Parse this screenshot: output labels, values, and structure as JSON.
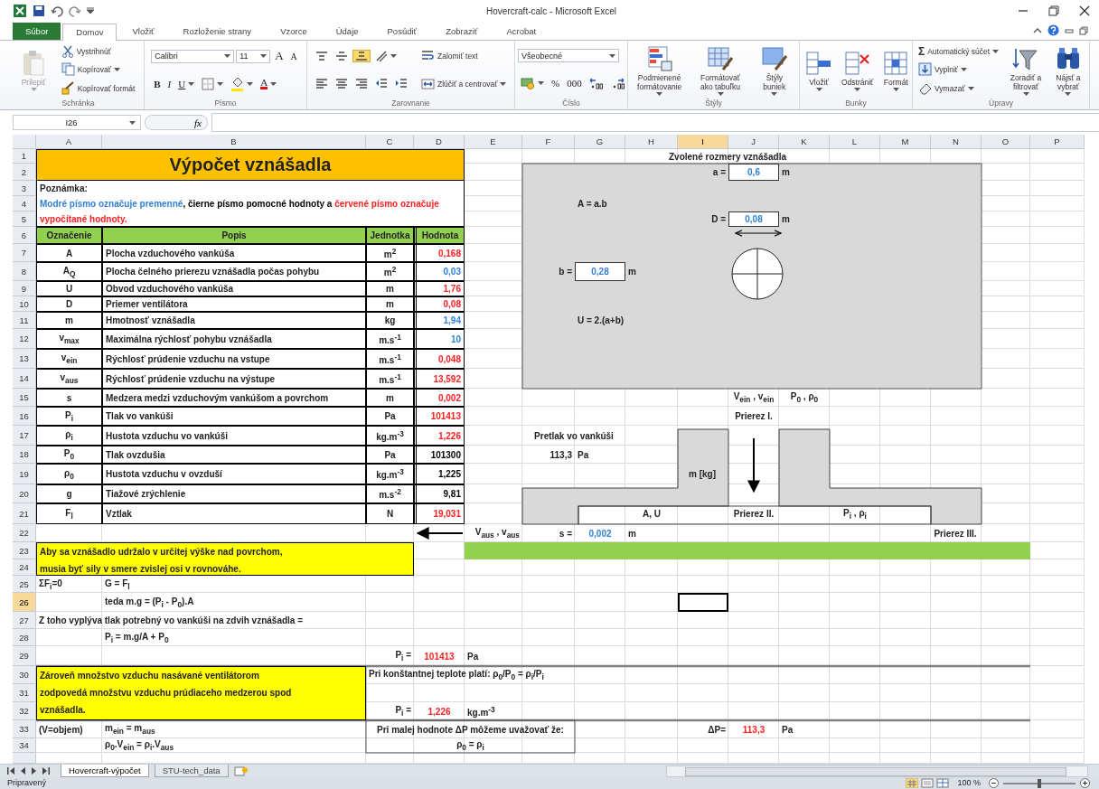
{
  "window": {
    "title": "Hovercraft-calc - Microsoft Excel"
  },
  "tabs": [
    {
      "label": "Súbor",
      "kind": "file",
      "selected": false
    },
    {
      "label": "Domov",
      "kind": "tab",
      "selected": true
    },
    {
      "label": "Vložiť",
      "kind": "tab",
      "selected": false
    },
    {
      "label": "Rozloženie strany",
      "kind": "tab",
      "selected": false
    },
    {
      "label": "Vzorce",
      "kind": "tab",
      "selected": false
    },
    {
      "label": "Údaje",
      "kind": "tab",
      "selected": false
    },
    {
      "label": "Posúdiť",
      "kind": "tab",
      "selected": false
    },
    {
      "label": "Zobraziť",
      "kind": "tab",
      "selected": false
    },
    {
      "label": "Acrobat",
      "kind": "tab",
      "selected": false
    }
  ],
  "ribbon": [
    {
      "label": "Schránka",
      "columns": [
        [
          [
            {
              "kind": "large",
              "label": "Prilepiť",
              "disabled": true,
              "menu": true
            }
          ]
        ],
        [
          [
            {
              "kind": "small",
              "label": "Vystrihnúť",
              "disabled": false
            }
          ],
          [
            {
              "kind": "small",
              "label": "Kopírovať",
              "disabled": false,
              "menu": true
            }
          ],
          [
            {
              "kind": "small",
              "label": "Kopírovať formát",
              "disabled": false
            }
          ]
        ]
      ]
    },
    {
      "label": "Písmo",
      "columns": [
        [
          [
            {
              "kind": "field",
              "label": "Calibri"
            },
            {
              "kind": "field",
              "label": "11"
            },
            {
              "kind": "grow",
              "label": "A"
            },
            {
              "kind": "shrink",
              "label": "A"
            }
          ],
          [
            {
              "kind": "bold",
              "label": "B"
            },
            {
              "kind": "italic",
              "label": "I"
            },
            {
              "kind": "underline",
              "label": "U",
              "menu": true
            },
            {
              "kind": "icon",
              "menu": true
            },
            {
              "kind": "icon",
              "menu": true
            },
            {
              "kind": "font-color",
              "label": "A",
              "menu": true
            }
          ]
        ]
      ]
    },
    {
      "label": "Zarovnanie",
      "columns": [
        [
          [
            {
              "kind": "icon",
              "selected": false
            },
            {
              "kind": "icon",
              "selected": false
            },
            {
              "kind": "icon",
              "selected": true
            },
            {
              "kind": "icon",
              "selected": false,
              "menu": true
            }
          ],
          [
            {
              "kind": "icon",
              "selected": false
            },
            {
              "kind": "icon",
              "selected": false
            },
            {
              "kind": "icon",
              "selected": false
            },
            {
              "kind": "icon",
              "selected": false
            },
            {
              "kind": "icon",
              "selected": false
            }
          ]
        ],
        [
          [
            {
              "kind": "small",
              "label": "Zalomiť text"
            }
          ],
          [
            {
              "kind": "small",
              "label": "Zlúčiť a centrovať",
              "menu": true
            }
          ]
        ]
      ]
    },
    {
      "label": "Číslo",
      "columns": [
        [
          [
            {
              "kind": "field",
              "label": "Všeobecné"
            }
          ],
          [
            {
              "kind": "icon",
              "menu": true
            },
            {
              "kind": "glyph",
              "label": "%"
            },
            {
              "kind": "glyph",
              "label": "000"
            },
            {
              "kind": "icon"
            },
            {
              "kind": "icon"
            }
          ]
        ]
      ]
    },
    {
      "label": "Štýly",
      "columns": [
        [
          [
            {
              "kind": "large",
              "label": "Podmienené formátovanie",
              "menu": true
            }
          ]
        ],
        [
          [
            {
              "kind": "large",
              "label": "Formátovať ako tabuľku",
              "menu": true
            }
          ]
        ],
        [
          [
            {
              "kind": "large",
              "label": "Štýly buniek",
              "menu": true
            }
          ]
        ]
      ]
    },
    {
      "label": "Bunky",
      "columns": [
        [
          [
            {
              "kind": "large",
              "label": "Vložiť",
              "menu": true
            }
          ]
        ],
        [
          [
            {
              "kind": "large",
              "label": "Odstrániť",
              "menu": true
            }
          ]
        ],
        [
          [
            {
              "kind": "large",
              "label": "Formát",
              "menu": true
            }
          ]
        ]
      ]
    },
    {
      "label": "Úpravy",
      "columns": [
        [
          [
            {
              "kind": "small",
              "glyph": "Σ",
              "label": "Automatický súčet",
              "menu": true
            }
          ],
          [
            {
              "kind": "small",
              "label": "Vyplniť",
              "menu": true
            }
          ],
          [
            {
              "kind": "small",
              "label": "Vymazať",
              "menu": true
            }
          ]
        ],
        [
          [
            {
              "kind": "large",
              "label": "Zoradiť a filtrovať",
              "menu": true
            }
          ]
        ],
        [
          [
            {
              "kind": "large",
              "label": "Nájsť a vybrať",
              "menu": true
            }
          ]
        ]
      ]
    }
  ],
  "formula_bar": {
    "name_box": "I26",
    "function_label": "fx"
  },
  "column_headers": [
    {
      "label": "A",
      "selected": false
    },
    {
      "label": "B",
      "selected": false
    },
    {
      "label": "C",
      "selected": false
    },
    {
      "label": "D",
      "selected": false
    },
    {
      "label": "E",
      "selected": false
    },
    {
      "label": "F",
      "selected": false
    },
    {
      "label": "G",
      "selected": false
    },
    {
      "label": "H",
      "selected": false
    },
    {
      "label": "I",
      "selected": true
    },
    {
      "label": "J",
      "selected": false
    },
    {
      "label": "K",
      "selected": false
    },
    {
      "label": "L",
      "selected": false
    },
    {
      "label": "M",
      "selected": false
    },
    {
      "label": "N",
      "selected": false
    },
    {
      "label": "O",
      "selected": false
    },
    {
      "label": "P",
      "selected": false
    }
  ],
  "row_headers": [
    {
      "label": "1",
      "selected": false
    },
    {
      "label": "2",
      "selected": false
    },
    {
      "label": "3",
      "selected": false
    },
    {
      "label": "4",
      "selected": false
    },
    {
      "label": "5",
      "selected": false
    },
    {
      "label": "6",
      "selected": false
    },
    {
      "label": "7",
      "selected": false
    },
    {
      "label": "8",
      "selected": false
    },
    {
      "label": "9",
      "selected": false
    },
    {
      "label": "10",
      "selected": false
    },
    {
      "label": "11",
      "selected": false
    },
    {
      "label": "12",
      "selected": false
    },
    {
      "label": "13",
      "selected": false
    },
    {
      "label": "14",
      "selected": false
    },
    {
      "label": "15",
      "selected": false
    },
    {
      "label": "16",
      "selected": false
    },
    {
      "label": "17",
      "selected": false
    },
    {
      "label": "18",
      "selected": false
    },
    {
      "label": "19",
      "selected": false
    },
    {
      "label": "20",
      "selected": false
    },
    {
      "label": "21",
      "selected": false
    },
    {
      "label": "22",
      "selected": false
    },
    {
      "label": "23",
      "selected": false
    },
    {
      "label": "24",
      "selected": false
    },
    {
      "label": "25",
      "selected": false
    },
    {
      "label": "26",
      "selected": true
    },
    {
      "label": "27",
      "selected": false
    },
    {
      "label": "28",
      "selected": false
    },
    {
      "label": "29",
      "selected": false
    },
    {
      "label": "30",
      "selected": false
    },
    {
      "label": "31",
      "selected": false
    },
    {
      "label": "32",
      "selected": false
    },
    {
      "label": "33",
      "selected": false
    },
    {
      "label": "34",
      "selected": false
    }
  ],
  "sheet_title": "Výpočet vznášadla",
  "note_label": "Poznámka:",
  "note": [
    {
      "text": "Modré písmo označuje premenné",
      "color": "#2f80d8"
    },
    {
      "text": ", čierne písmo pomocné hodnoty a ",
      "color": "#000000"
    },
    {
      "text": "červené písmo označuje vypočítané hodnoty.",
      "color": "#ff2020"
    }
  ],
  "table": {
    "columns": [
      "Označenie",
      "Popis",
      "Jednotka",
      "Hodnota"
    ],
    "rows": [
      {
        "symbol": "A",
        "description": "Plocha vzduchového vankúša",
        "unit": "m$^{2}$",
        "value": "0,168",
        "color": "#ff2020"
      },
      {
        "symbol": "A$_{Q}$",
        "description": "Plocha čelného prierezu vznášadla počas pohybu",
        "unit": "m$^{2}$",
        "value": "0,03",
        "color": "#2f80d8"
      },
      {
        "symbol": "U",
        "description": "Obvod vzduchového vankúša",
        "unit": "m",
        "value": "1,76",
        "color": "#ff2020"
      },
      {
        "symbol": "D",
        "description": "Priemer ventilátora",
        "unit": "m",
        "value": "0,08",
        "color": "#ff2020"
      },
      {
        "symbol": "m",
        "description": "Hmotnosť vznášadla",
        "unit": "kg",
        "value": "1,94",
        "color": "#2f80d8"
      },
      {
        "symbol": "v$_{max}$",
        "description": "Maximálna rýchlosť pohybu vznášadla",
        "unit": "m.s$^{-1}$",
        "value": "10",
        "color": "#2f80d8"
      },
      {
        "symbol": "v$_{ein}$",
        "description": "Rýchlosť prúdenie vzduchu na vstupe",
        "unit": "m.s$^{-1}$",
        "value": "0,048",
        "color": "#ff2020"
      },
      {
        "symbol": "v$_{aus}$",
        "description": "Rýchlosť prúdenie vzduchu na výstupe",
        "unit": "m.s$^{-1}$",
        "value": "13,592",
        "color": "#ff2020"
      },
      {
        "symbol": "s",
        "description": "Medzera medzi vzduchovým vankúšom a povrchom",
        "unit": "m",
        "value": "0,002",
        "color": "#ff2020"
      },
      {
        "symbol": "P$_{i}$",
        "description": "Tlak vo vankúši",
        "unit": "Pa",
        "value": "101413",
        "color": "#ff2020"
      },
      {
        "symbol": "ρ$_{i}$",
        "description": "Hustota vzduchu vo vankúši",
        "unit": "kg.m$^{-3}$",
        "value": "1,226",
        "color": "#ff2020"
      },
      {
        "symbol": "P$_{0}$",
        "description": "Tlak ovzdušia",
        "unit": "Pa",
        "value": "101300",
        "color": "#000000"
      },
      {
        "symbol": "ρ$_{0}$",
        "description": "Hustota vzduchu v ovzduší",
        "unit": "kg.m$^{-3}$",
        "value": "1,225",
        "color": "#000000"
      },
      {
        "symbol": "g",
        "description": "Tiažové zrýchlenie",
        "unit": "m.s$^{-2}$",
        "value": "9,81",
        "color": "#000000"
      },
      {
        "symbol": "F$_{l}$",
        "description": "Vztlak",
        "unit": "N",
        "value": "19,031",
        "color": "#ff2020"
      }
    ]
  },
  "sheet_texts": [
    {
      "kind": "text",
      "text": "Zvolené rozmery vznášadla"
    },
    {
      "kind": "text",
      "text": "a ="
    },
    {
      "kind": "input",
      "text": "0,6",
      "color": "#2f80d8"
    },
    {
      "kind": "text",
      "text": "m"
    },
    {
      "kind": "text",
      "text": "A = a.b"
    },
    {
      "kind": "text",
      "text": "D ="
    },
    {
      "kind": "input",
      "text": "0,08",
      "color": "#2f80d8"
    },
    {
      "kind": "text",
      "text": "m"
    },
    {
      "kind": "text",
      "text": "b ="
    },
    {
      "kind": "input",
      "text": "0,28",
      "color": "#2f80d8"
    },
    {
      "kind": "text",
      "text": "m"
    },
    {
      "kind": "text",
      "text": "U = 2.(a+b)"
    },
    {
      "kind": "text",
      "text": "V$_{ein}$ , v$_{ein}$"
    },
    {
      "kind": "text",
      "text": "P$_{0}$ , ρ$_{0}$"
    },
    {
      "kind": "text",
      "text": "Prierez I."
    },
    {
      "kind": "text",
      "text": "Pretlak vo vankúši"
    },
    {
      "kind": "text",
      "text": "113,3"
    },
    {
      "kind": "text",
      "text": "Pa"
    },
    {
      "kind": "text",
      "text": "m [kg]"
    },
    {
      "kind": "text",
      "text": "A, U"
    },
    {
      "kind": "text",
      "text": "Prierez II."
    },
    {
      "kind": "text",
      "text": "P$_{i}$ , ρ$_{i}$"
    },
    {
      "kind": "text",
      "text": "V$_{aus}$ , v$_{aus}$"
    },
    {
      "kind": "text",
      "text": "s ="
    },
    {
      "kind": "text",
      "text": "0,002",
      "color": "#2f80d8"
    },
    {
      "kind": "text",
      "text": "m"
    },
    {
      "kind": "text",
      "text": "Prierez III."
    },
    {
      "kind": "text",
      "text": "ΣF$_{i}$=0"
    },
    {
      "kind": "text",
      "text": "G = F$_{l}$"
    },
    {
      "kind": "text",
      "text": "teda m.g = (P$_{i}$ - P$_{0}$).A"
    },
    {
      "kind": "text",
      "text": "Z toho vyplýva tlak potrebný vo vankúši na zdvih vznášadla ="
    },
    {
      "kind": "text",
      "text": "P$_{i}$ = m.g/A + P$_{0}$"
    },
    {
      "kind": "text",
      "text": "P$_{i}$ ="
    },
    {
      "kind": "text",
      "text": "101413",
      "color": "#ff2020"
    },
    {
      "kind": "text",
      "text": "Pa"
    },
    {
      "kind": "text",
      "text": "Pri konštantnej teplote platí: ρ$_{0}$/P$_{0}$ = ρ$_{i}$/P$_{i}$"
    },
    {
      "kind": "text",
      "text": "P$_{i}$ ="
    },
    {
      "kind": "text",
      "text": "1,226",
      "color": "#ff2020"
    },
    {
      "kind": "text",
      "text": "kg.m$^{-3}$"
    },
    {
      "kind": "text",
      "text": "(V=objem)"
    },
    {
      "kind": "text",
      "text": "m$_{ein}$ = m$_{aus}$"
    },
    {
      "kind": "text",
      "text": "Pri malej hodnote ΔP môžeme uvažovať že:"
    },
    {
      "kind": "text",
      "text": "ΔP="
    },
    {
      "kind": "text",
      "text": "113,3",
      "color": "#ff2020"
    },
    {
      "kind": "text",
      "text": "Pa"
    },
    {
      "kind": "text",
      "text": "ρ$_{0}$.V$_{ein}$ = ρ$_{i}$.V$_{aus}$"
    },
    {
      "kind": "text",
      "text": "ρ$_{0}$ = ρ$_{i}$"
    }
  ],
  "callouts": [
    {
      "lines": [
        "Aby sa vznášadlo udržalo v určitej výške nad povrchom,",
        "musia byť sily v smere zvislej osi v rovnováhe."
      ]
    },
    {
      "lines": [
        "Zároveň množstvo vzduchu nasávané ventilátorom",
        "zodpovedá množstvu vzduchu prúdiaceho medzerou spod",
        "vznášadla."
      ]
    }
  ],
  "sheet_tabs": [
    {
      "label": "Hovercraft-výpočet",
      "selected": true
    },
    {
      "label": "STU-tech_data",
      "selected": false
    }
  ],
  "status_bar": {
    "text": "Pripravený",
    "zoom": "100 %",
    "zoom_slider": {
      "level": 0.5
    }
  }
}
